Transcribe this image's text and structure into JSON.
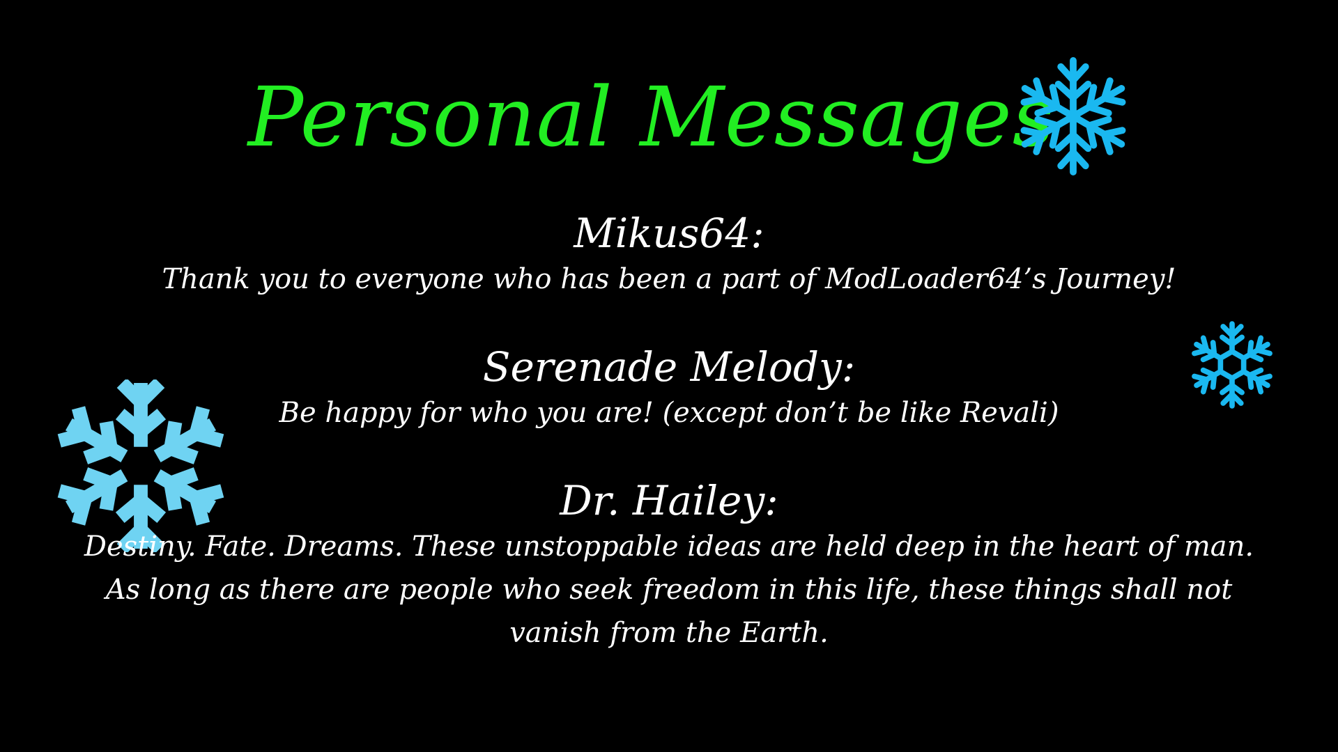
{
  "title": "Personal Messages",
  "messages": [
    {
      "name": "Mikus64:",
      "text": "Thank you to everyone who has been a part of ModLoader64’s Journey!"
    },
    {
      "name": "Serenade Melody:",
      "text": "Be happy for who you are! (except don’t be like Revali)"
    },
    {
      "name": "Dr. Hailey:",
      "text": "Destiny. Fate. Dreams. These unstoppable ideas are held deep in the heart of man. As long as there are people who seek freedom in this life, these things shall not vanish from the Earth."
    }
  ],
  "icons": [
    "snowflake-icon",
    "snowflake-icon",
    "snowflake-icon"
  ],
  "colors": {
    "background": "#000000",
    "title": "#22ee22",
    "text": "#ffffff",
    "snowflake_bright": "#1ab8f0",
    "snowflake_light": "#6fd3f2"
  }
}
